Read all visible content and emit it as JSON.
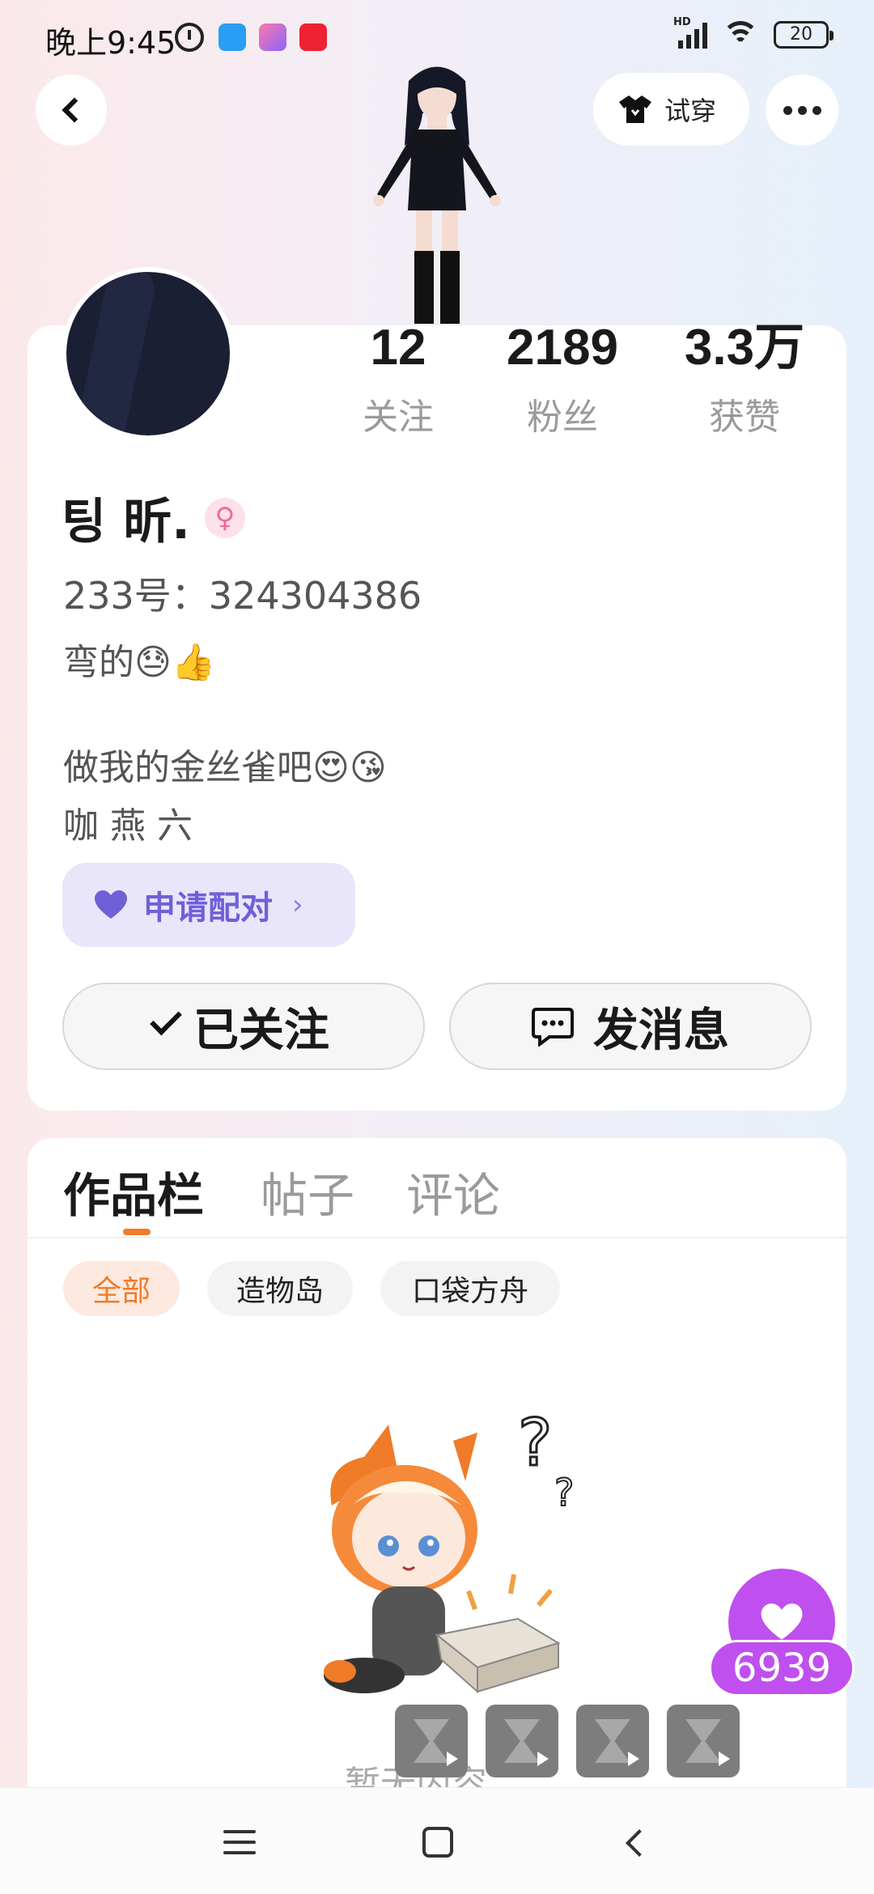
{
  "status_bar": {
    "time": "晚上9:45",
    "hd": "HD",
    "battery": "20"
  },
  "top_bar": {
    "try_on_label": "试穿"
  },
  "stats": [
    {
      "value": "12",
      "label": "关注"
    },
    {
      "value": "2189",
      "label": "粉丝"
    },
    {
      "value": "3.3万",
      "label": "获赞"
    }
  ],
  "profile": {
    "username": "팅  昕.",
    "gender_symbol": "♀",
    "uid": "233号：324304386",
    "bio_lines": [
      "弯的😓👍",
      "做我的金丝雀吧😍😘",
      "咖 燕 六"
    ]
  },
  "pair_button": {
    "label": "申请配对",
    "chevron": "›"
  },
  "actions": {
    "follow_label": "已关注",
    "message_label": "发消息"
  },
  "tabs": [
    {
      "label": "作品栏",
      "active": true
    },
    {
      "label": "帖子",
      "active": false
    },
    {
      "label": "评论",
      "active": false
    }
  ],
  "chips": [
    {
      "label": "全部",
      "active": true
    },
    {
      "label": "造物岛",
      "active": false
    },
    {
      "label": "口袋方舟",
      "active": false
    }
  ],
  "empty_state": {
    "text": "暂无内容"
  },
  "like_fab": {
    "count": "6939"
  },
  "colors": {
    "accent_orange": "#f07b28",
    "like_purple": "#c04ff0",
    "pair_purple": "#6f60d8"
  }
}
